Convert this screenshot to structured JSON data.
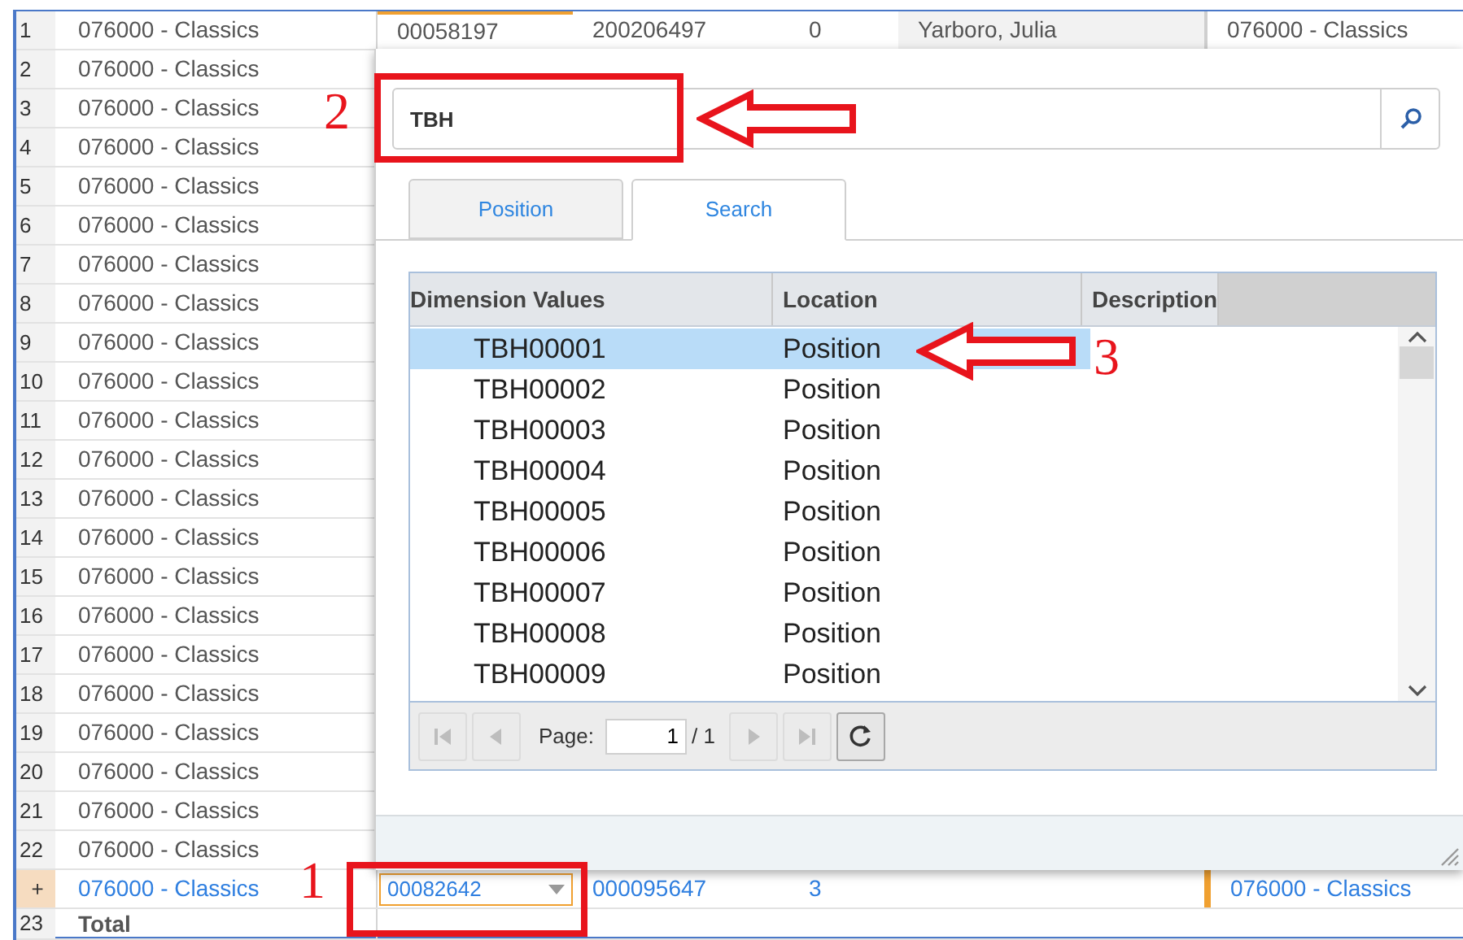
{
  "grid": {
    "rows": [
      {
        "number": "1",
        "kind": "data",
        "department": "076000 - Classics",
        "cells": [
          "00058197",
          "200206497",
          "0",
          "Yarboro, Julia",
          "076000 - Classics"
        ]
      },
      {
        "number": "2",
        "kind": "data",
        "department": "076000 - Classics"
      },
      {
        "number": "3",
        "kind": "data",
        "department": "076000 - Classics"
      },
      {
        "number": "4",
        "kind": "data",
        "department": "076000 - Classics"
      },
      {
        "number": "5",
        "kind": "data",
        "department": "076000 - Classics"
      },
      {
        "number": "6",
        "kind": "data",
        "department": "076000 - Classics"
      },
      {
        "number": "7",
        "kind": "data",
        "department": "076000 - Classics"
      },
      {
        "number": "8",
        "kind": "data",
        "department": "076000 - Classics"
      },
      {
        "number": "9",
        "kind": "data",
        "department": "076000 - Classics"
      },
      {
        "number": "10",
        "kind": "data",
        "department": "076000 - Classics"
      },
      {
        "number": "11",
        "kind": "data",
        "department": "076000 - Classics"
      },
      {
        "number": "12",
        "kind": "data",
        "department": "076000 - Classics"
      },
      {
        "number": "13",
        "kind": "data",
        "department": "076000 - Classics"
      },
      {
        "number": "14",
        "kind": "data",
        "department": "076000 - Classics"
      },
      {
        "number": "15",
        "kind": "data",
        "department": "076000 - Classics"
      },
      {
        "number": "16",
        "kind": "data",
        "department": "076000 - Classics"
      },
      {
        "number": "17",
        "kind": "data",
        "department": "076000 - Classics"
      },
      {
        "number": "18",
        "kind": "data",
        "department": "076000 - Classics"
      },
      {
        "number": "19",
        "kind": "data",
        "department": "076000 - Classics"
      },
      {
        "number": "20",
        "kind": "data",
        "department": "076000 - Classics"
      },
      {
        "number": "21",
        "kind": "data",
        "department": "076000 - Classics"
      },
      {
        "number": "22",
        "kind": "data",
        "department": "076000 - Classics"
      },
      {
        "number": "+",
        "kind": "new",
        "department": "076000 - Classics",
        "cells": [
          "00082642",
          "000095647",
          "3",
          "",
          "076000 - Classics"
        ]
      },
      {
        "number": "23",
        "kind": "total",
        "department": "Total"
      }
    ]
  },
  "lookup": {
    "search": {
      "value": "TBH"
    },
    "tabs": [
      {
        "label": "Position",
        "selected": false
      },
      {
        "label": "Search",
        "selected": true
      }
    ],
    "columns": [
      "Dimension Values",
      "Location",
      "Description"
    ],
    "rows": [
      {
        "value": "TBH00001",
        "location": "Position",
        "selected": true
      },
      {
        "value": "TBH00002",
        "location": "Position",
        "selected": false
      },
      {
        "value": "TBH00003",
        "location": "Position",
        "selected": false
      },
      {
        "value": "TBH00004",
        "location": "Position",
        "selected": false
      },
      {
        "value": "TBH00005",
        "location": "Position",
        "selected": false
      },
      {
        "value": "TBH00006",
        "location": "Position",
        "selected": false
      },
      {
        "value": "TBH00007",
        "location": "Position",
        "selected": false
      },
      {
        "value": "TBH00008",
        "location": "Position",
        "selected": false
      },
      {
        "value": "TBH00009",
        "location": "Position",
        "selected": false
      }
    ],
    "pager": {
      "label": "Page:",
      "page": "1",
      "total": "/ 1",
      "buttons": [
        {
          "kind": "first",
          "disabled": true
        },
        {
          "kind": "prev",
          "disabled": true
        },
        {
          "kind": "next",
          "disabled": true
        },
        {
          "kind": "last",
          "disabled": true
        },
        {
          "kind": "refresh",
          "disabled": false
        }
      ]
    }
  },
  "annotations": [
    {
      "kind": "field",
      "number": "2"
    },
    {
      "kind": "row",
      "number": "3"
    },
    {
      "kind": "cell",
      "number": "1"
    }
  ]
}
